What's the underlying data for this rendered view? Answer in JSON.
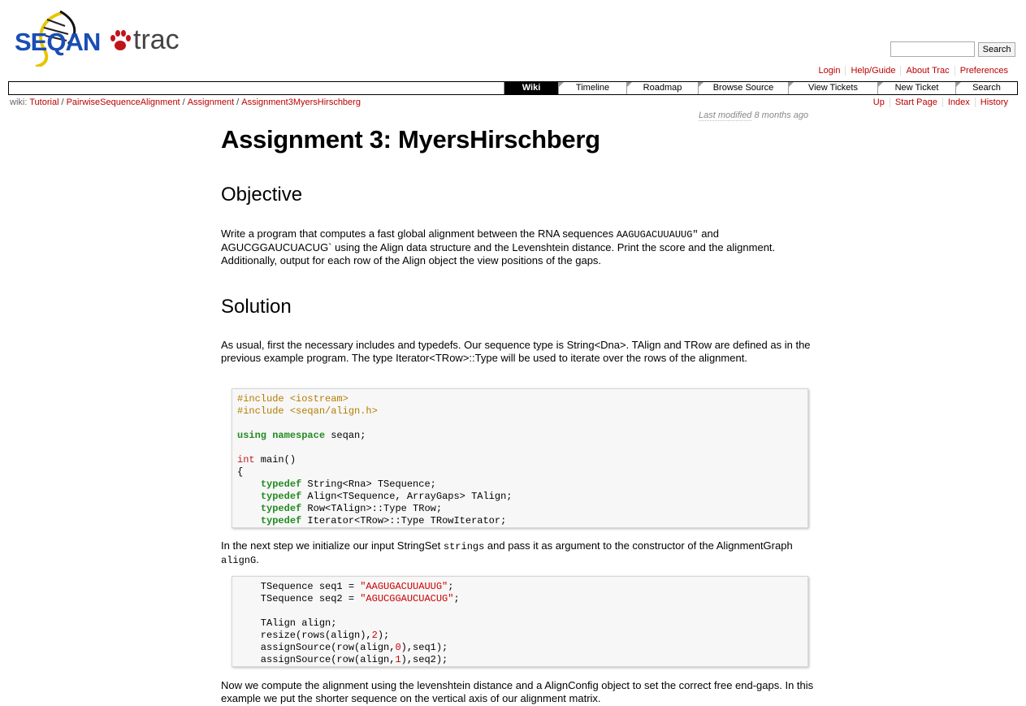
{
  "logo": {
    "seqan": "SEQAN",
    "trac": "trac"
  },
  "search": {
    "button_label": "Search",
    "placeholder": ""
  },
  "metanav": [
    "Login",
    "Help/Guide",
    "About Trac",
    "Preferences"
  ],
  "mainnav": [
    {
      "label": "Wiki",
      "active": true
    },
    {
      "label": "Timeline"
    },
    {
      "label": "Roadmap"
    },
    {
      "label": "Browse Source"
    },
    {
      "label": "View Tickets"
    },
    {
      "label": "New Ticket"
    },
    {
      "label": "Search"
    }
  ],
  "breadcrumb": {
    "prefix": "wiki:",
    "items": [
      "Tutorial",
      "PairwiseSequenceAlignment",
      "Assignment",
      "Assignment3MyersHirschberg"
    ]
  },
  "ctxtnav": [
    "Up",
    "Start Page",
    "Index",
    "History"
  ],
  "last_modified": {
    "prefix": "Last modified",
    "age": "8 months ago"
  },
  "page": {
    "title": "Assignment 3: MyersHirschberg",
    "objective_heading": "Objective",
    "objective_text_1": "Write a program that computes a fast global alignment between the RNA sequences ",
    "objective_seq_1": "AAGUGACUUAUUG\"",
    "objective_text_2": " and ",
    "objective_seq_2": "AGUCGGAUCUACUG`",
    "objective_text_3": " using the Align data structure and the Levenshtein distance. Print the score and the alignment. Additionally, output for each row of the Align object the view positions of the gaps.",
    "solution_heading": "Solution",
    "solution_text_1": "As usual, first the necessary includes and typedefs. Our sequence type is String<Dna>. TAlign and TRow are defined as in the previous example program. The type Iterator<TRow>::Type will be used to iterate over the rows of the alignment.",
    "solution_text_2a": "In the next step we initialize our input StringSet ",
    "solution_text_2_code1": "strings",
    "solution_text_2b": " and pass it as argument to the constructor of the AlignmentGraph ",
    "solution_text_2_code2": "alignG",
    "solution_text_2c": ".",
    "solution_text_3": "Now we compute the alignment using the levenshtein distance and a AlignConfig object to set the correct free end-gaps. In this example we put the shorter sequence on the vertical axis of our alignment matrix."
  },
  "code1": {
    "inc1_kw": "#include",
    "inc1_file": "<iostream>",
    "inc2_kw": "#include",
    "inc2_file": "<seqan/align.h>",
    "using_kw": "using",
    "namespace_kw": "namespace",
    "ns_name": " seqan;",
    "int_kw": "int",
    "main_sig": " main()",
    "brace": "{",
    "td_kw": "typedef",
    "td1": " String<Rna> TSequence;",
    "td2": " Align<TSequence, ArrayGaps> TAlign;",
    "td3": " Row<TAlign>::Type TRow;",
    "td4": " Iterator<TRow>::Type TRowIterator;"
  },
  "code2": {
    "l1a": "    TSequence seq1 = ",
    "l1s": "\"AAGUGACUUAUUG\"",
    "l1b": ";",
    "l2a": "    TSequence seq2 = ",
    "l2s": "\"AGUCGGAUCUACUG\"",
    "l2b": ";",
    "l3": "    TAlign align;",
    "l4a": "    resize(rows(align),",
    "l4n": "2",
    "l4b": ");",
    "l5a": "    assignSource(row(align,",
    "l5n": "0",
    "l5b": "),seq1);",
    "l6a": "    assignSource(row(align,",
    "l6n": "1",
    "l6b": "),seq2);"
  }
}
